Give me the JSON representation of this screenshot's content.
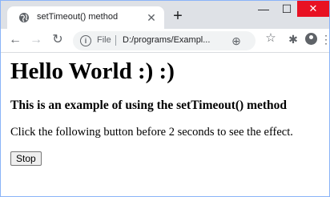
{
  "browser": {
    "tab_title": "setTimeout() method",
    "url_scheme": "File",
    "url": "D:/programs/Exampl...",
    "icons": {
      "favicon": "globe-icon",
      "close": "close-icon",
      "new_tab": "plus-icon",
      "back": "arrow-left-icon",
      "forward": "arrow-right-icon",
      "reload": "reload-icon",
      "info": "info-icon",
      "zoom": "zoom-icon",
      "bookmark": "star-icon",
      "extensions": "puzzle-icon",
      "profile": "avatar-icon",
      "menu": "kebab-menu-icon"
    }
  },
  "page": {
    "heading": "Hello World :) :)",
    "subheading": "This is an example of using the setTimeout() method",
    "paragraph": "Click the following button before 2 seconds to see the effect.",
    "button_label": "Stop"
  }
}
